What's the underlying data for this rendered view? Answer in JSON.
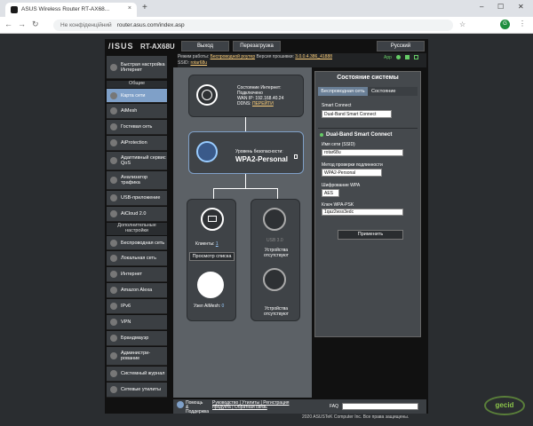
{
  "browser": {
    "tab_title": "ASUS Wireless Router RT-AX68...",
    "url_security": "Не конфіденційний",
    "url": "router.asus.com/index.asp",
    "tab_close": "×",
    "new_tab": "+",
    "win_min": "–",
    "win_max": "☐",
    "win_close": "✕",
    "back": "←",
    "forward": "→",
    "reload": "↻",
    "user": "G"
  },
  "header": {
    "logo": "/ISUS",
    "model": "RT-AX68U",
    "logout": "Выход",
    "reboot": "Перезагрузка",
    "language": "Русский",
    "mode_label": "Режим работы:",
    "mode_value": "Беспроводной роутер",
    "fw_label": "Версия прошивки:",
    "fw_value": "3.0.0.4.386_41888",
    "ssid_label": "SSID:",
    "ssid_value": "rotar68u",
    "app": "App"
  },
  "sidebar": {
    "quick": "Быстрая настройка Интернет",
    "general": "Общие",
    "items": [
      "Карта сети",
      "AiMesh",
      "Гостевая сеть",
      "AiProtection",
      "Адаптивный сервис QoS",
      "Анализатор трафика",
      "USB-приложение",
      "AiCloud 2.0"
    ],
    "advanced": "Дополнительные настройки",
    "adv_items": [
      "Беспроводная сеть",
      "Локальная сеть",
      "Интернет",
      "Amazon Alexa",
      "IPv6",
      "VPN",
      "Брандмауэр",
      "Администри-рование",
      "Системный журнал",
      "Сетевые утилиты"
    ]
  },
  "map": {
    "inet_status_label": "Состояние Интернет:",
    "inet_status": "Подключено",
    "wan_ip": "WAN IP: 192.168.40.24",
    "ddns": "DDNS:",
    "ddns_link": "ПЕРЕЙТИ",
    "sec_label": "Уровень безопасности:",
    "sec_value": "WPA2-Personal",
    "clients_label": "Клиенты:",
    "clients_count": "1",
    "view_list": "Просмотр списка",
    "usb1": "USB 3.0",
    "usb_none1": "Устройства отсутствуют",
    "usb_none2": "Устройства отсутствуют",
    "aimesh_node": "Узел AiMesh:",
    "aimesh_count": "0"
  },
  "status": {
    "title": "Состояние системы",
    "tab_wireless": "Беспроводная сеть",
    "tab_status": "Состояние",
    "smart_connect_label": "Smart Connect",
    "smart_connect_value": "Dual-Band Smart Connect",
    "band_title": "Dual-Band Smart Connect",
    "ssid_label": "Имя сети (SSID)",
    "ssid_value": "rotar68u",
    "auth_label": "Метод проверки подлинности",
    "auth_value": "WPA2-Personal",
    "enc_label": "Шифрование WPA",
    "enc_value": "AES",
    "key_label": "Ключ WPA-PSK",
    "key_value": "1qaz2wsx3edc",
    "apply": "Применить"
  },
  "footer": {
    "help": "Помощь & Поддержка",
    "links": "Руководство | Утилиты | Регистрация продукта | Обратная связь",
    "faq": "FAQ",
    "copyright": "2020 ASUSTeK Computer Inc. Все права защищены."
  }
}
